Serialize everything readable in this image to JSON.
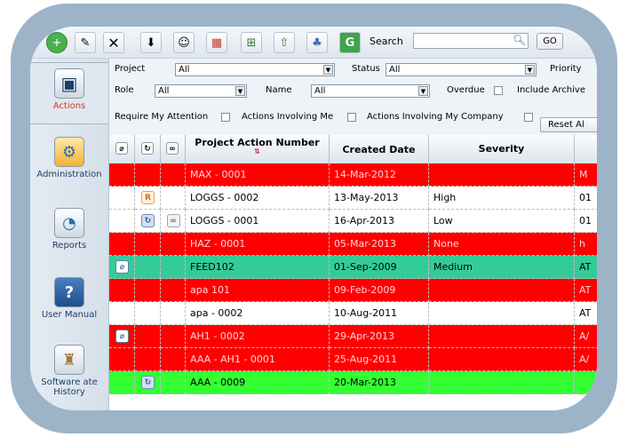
{
  "colors": {
    "frame": "#9db3c8",
    "row_red": "#ff0000",
    "row_teal": "#33cc99",
    "row_green": "#33ff33",
    "row_white": "#ffffff",
    "red_text": "#ffd6d6",
    "active_nav_label": "#e0301e"
  },
  "toolbar": {
    "search_label": "Search",
    "search_value": "",
    "go_label": "GO",
    "icons": [
      "add-icon",
      "edit-icon",
      "delete-icon",
      "export-icon",
      "people-icon",
      "calendar-icon",
      "excel-icon",
      "upload-icon",
      "group-icon",
      "refresh-icon"
    ]
  },
  "sidebar": {
    "items": [
      {
        "label": "Actions",
        "icon": "actions-icon"
      },
      {
        "label": "Administration",
        "icon": "gears-icon"
      },
      {
        "label": "Reports",
        "icon": "chart-icon"
      },
      {
        "label": "User Manual",
        "icon": "help-book-icon"
      },
      {
        "label": "Software ate History",
        "icon": "history-icon"
      }
    ]
  },
  "filters": {
    "project_label": "Project",
    "project_value": "All",
    "status_label": "Status",
    "status_value": "All",
    "priority_label": "Priority",
    "role_label": "Role",
    "role_value": "All",
    "name_label": "Name",
    "name_value": "All",
    "overdue_label": "Overdue",
    "include_archive_label": "Include Archive",
    "require_attention_label": "Require My Attention",
    "involving_me_label": "Actions Involving Me",
    "involving_company_label": "Actions Involving My Company",
    "reset_label": "Reset Al"
  },
  "grid": {
    "columns": {
      "number": "Project Action Number",
      "created": "Created Date",
      "severity": "Severity"
    },
    "rows": [
      {
        "icons": [
          "",
          "",
          ""
        ],
        "number": "MAX - 0001",
        "created": "14-Mar-2012",
        "severity": "",
        "extra": "M",
        "color": "red"
      },
      {
        "icons": [
          "",
          "r-icon",
          ""
        ],
        "number": "LOGGS - 0002",
        "created": "13-May-2013",
        "severity": "High",
        "extra": "01",
        "color": "white"
      },
      {
        "icons": [
          "",
          "refresh-icon",
          "link-icon"
        ],
        "number": "LOGGS - 0001",
        "created": "16-Apr-2013",
        "severity": "Low",
        "extra": "01",
        "color": "white"
      },
      {
        "icons": [
          "",
          "",
          ""
        ],
        "number": "HAZ - 0001",
        "created": "05-Mar-2013",
        "severity": "None",
        "extra": "h",
        "color": "red"
      },
      {
        "icons": [
          "attach-icon",
          "",
          ""
        ],
        "number": "FEED102",
        "created": "01-Sep-2009",
        "severity": "Medium",
        "extra": "AT",
        "color": "teal"
      },
      {
        "icons": [
          "",
          "",
          ""
        ],
        "number": "apa 101",
        "created": "09-Feb-2009",
        "severity": "",
        "extra": "AT",
        "color": "red"
      },
      {
        "icons": [
          "",
          "",
          ""
        ],
        "number": "apa - 0002",
        "created": "10-Aug-2011",
        "severity": "",
        "extra": "AT",
        "color": "white"
      },
      {
        "icons": [
          "attach-icon",
          "",
          ""
        ],
        "number": "AH1 - 0002",
        "created": "29-Apr-2013",
        "severity": "",
        "extra": "A/",
        "color": "red"
      },
      {
        "icons": [
          "",
          "",
          ""
        ],
        "number": "AAA - AH1 - 0001",
        "created": "25-Aug-2011",
        "severity": "",
        "extra": "A/",
        "color": "red"
      },
      {
        "icons": [
          "",
          "refresh-icon",
          ""
        ],
        "number": "AAA - 0009",
        "created": "20-Mar-2013",
        "severity": "",
        "extra": "",
        "color": "green"
      }
    ]
  }
}
